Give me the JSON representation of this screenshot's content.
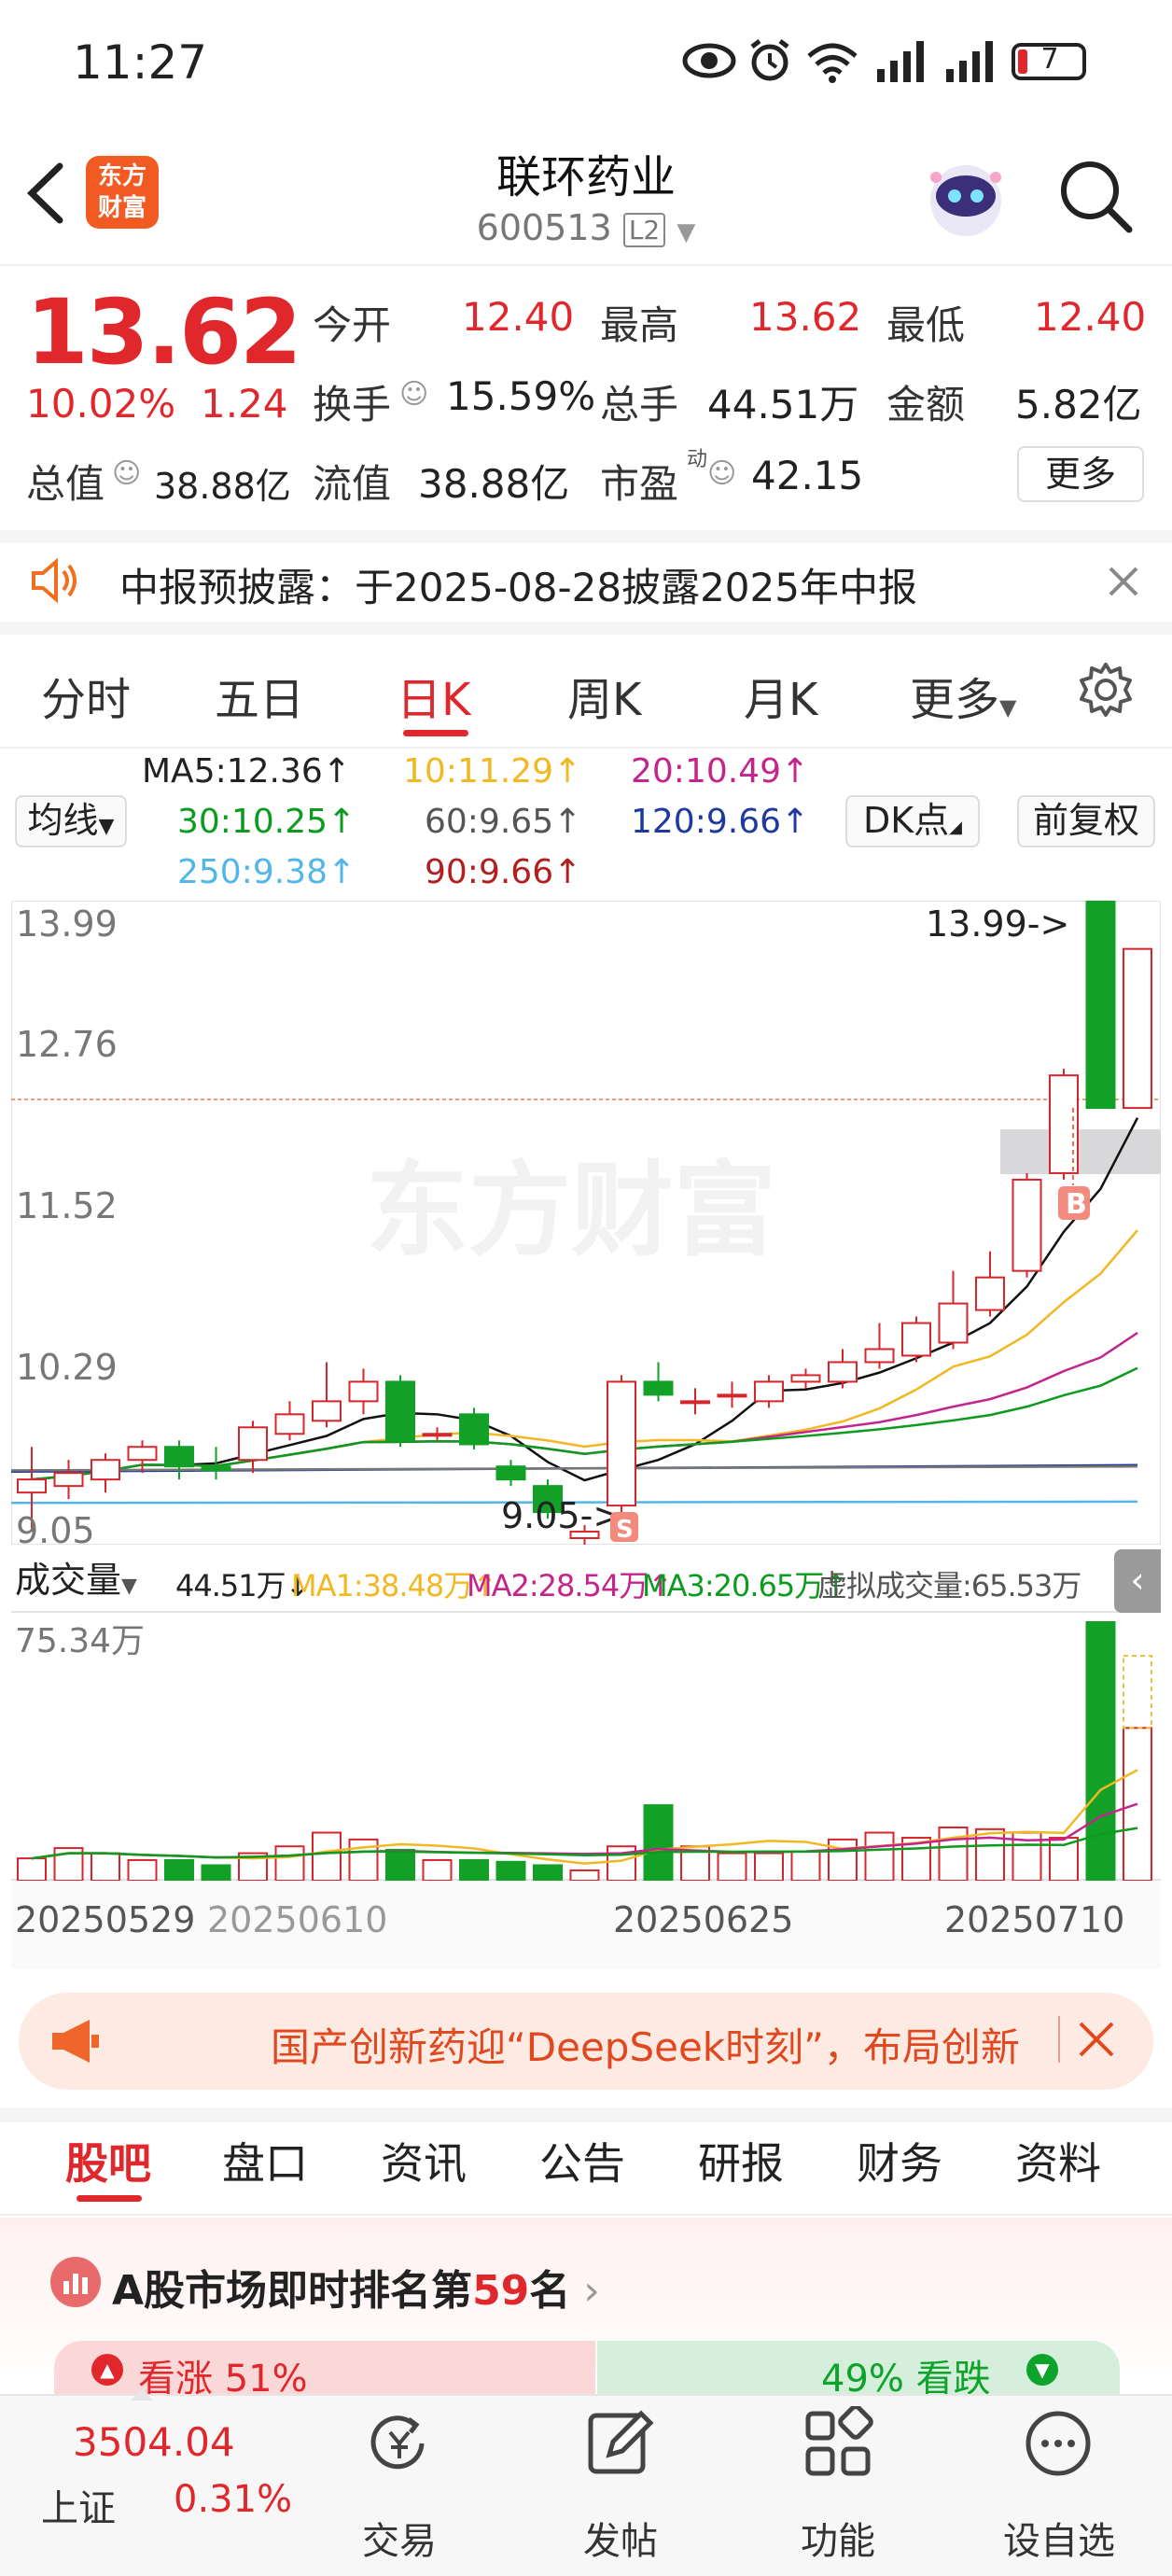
{
  "status": {
    "time": "11:27",
    "battery": "7"
  },
  "header": {
    "title": "联环药业",
    "code": "600513",
    "level": "L2",
    "logo_line1": "东方",
    "logo_line2": "财富"
  },
  "quote": {
    "price": "13.62",
    "change_pct": "10.02%",
    "change": "1.24",
    "open_label": "今开",
    "open": "12.40",
    "high_label": "最高",
    "high": "13.62",
    "low_label": "最低",
    "low": "12.40",
    "turnover_label": "换手",
    "turnover": "15.59%",
    "volume_label": "总手",
    "volume": "44.51万",
    "amount_label": "金额",
    "amount": "5.82亿",
    "mcap_label": "总值",
    "mcap": "38.88亿",
    "float_label": "流值",
    "float": "38.88亿",
    "pe_label": "市盈",
    "pe_sup": "动",
    "pe": "42.15",
    "more": "更多"
  },
  "notice": {
    "text": "中报预披露：于2025-08-28披露2025年中报"
  },
  "tabs": [
    "分时",
    "五日",
    "日K",
    "周K",
    "月K",
    "更多"
  ],
  "ma": {
    "select": "均线",
    "ma5": "MA5:12.36↑",
    "ma10": "10:11.29↑",
    "ma20": "20:10.49↑",
    "ma30": "30:10.25↑",
    "ma60": "60:9.65↑",
    "ma120": "120:9.66↑",
    "ma250": "250:9.38↑",
    "ma90": "90:9.66↑",
    "dk": "DK点",
    "fq": "前复权"
  },
  "chart_labels": {
    "y_top": "13.99",
    "y2": "12.76",
    "y3": "11.52",
    "y4": "10.29",
    "y_bottom": "9.05",
    "max_marker": "13.99->",
    "min_marker": "9.05->",
    "watermark": "东方财富",
    "buy": "B",
    "sell": "S"
  },
  "volume": {
    "select": "成交量",
    "vol": "44.51万↓",
    "ma1": "MA1:38.48万↑",
    "ma2": "MA2:28.54万↑",
    "ma3": "MA3:20.65万↑",
    "virtual": "虚拟成交量:65.53万",
    "y_max": "75.34万"
  },
  "dates": [
    "20250529",
    "20250610",
    "20250625",
    "20250710"
  ],
  "chart_data": {
    "type": "candlestick",
    "ylim": [
      9.05,
      13.99
    ],
    "candles": [
      {
        "o": 9.45,
        "c": 9.55,
        "h": 9.8,
        "l": 9.15,
        "v": 6.5
      },
      {
        "o": 9.5,
        "c": 9.6,
        "h": 9.7,
        "l": 9.4,
        "v": 9.5
      },
      {
        "o": 9.55,
        "c": 9.7,
        "h": 9.75,
        "l": 9.45,
        "v": 8.0
      },
      {
        "o": 9.7,
        "c": 9.8,
        "h": 9.85,
        "l": 9.6,
        "v": 6.0
      },
      {
        "o": 9.8,
        "c": 9.65,
        "h": 9.85,
        "l": 9.55,
        "v": 6.0
      },
      {
        "o": 9.65,
        "c": 9.62,
        "h": 9.8,
        "l": 9.55,
        "v": 4.5
      },
      {
        "o": 9.7,
        "c": 9.95,
        "h": 10.0,
        "l": 9.6,
        "v": 8.0
      },
      {
        "o": 9.9,
        "c": 10.05,
        "h": 10.15,
        "l": 9.85,
        "v": 10.0
      },
      {
        "o": 10.0,
        "c": 10.15,
        "h": 10.45,
        "l": 9.95,
        "v": 14.0
      },
      {
        "o": 10.15,
        "c": 10.3,
        "h": 10.4,
        "l": 10.05,
        "v": 12.0
      },
      {
        "o": 10.3,
        "c": 9.85,
        "h": 10.35,
        "l": 9.8,
        "v": 9.0
      },
      {
        "o": 9.9,
        "c": 9.9,
        "h": 9.95,
        "l": 9.85,
        "v": 6.0
      },
      {
        "o": 10.05,
        "c": 9.82,
        "h": 10.1,
        "l": 9.78,
        "v": 6.0
      },
      {
        "o": 9.65,
        "c": 9.55,
        "h": 9.7,
        "l": 9.5,
        "v": 5.5
      },
      {
        "o": 9.5,
        "c": 9.3,
        "h": 9.55,
        "l": 9.25,
        "v": 4.5
      },
      {
        "o": 9.1,
        "c": 9.15,
        "h": 9.2,
        "l": 9.05,
        "v": 3.0
      },
      {
        "o": 9.35,
        "c": 10.3,
        "h": 10.35,
        "l": 9.3,
        "v": 10.0
      },
      {
        "o": 10.3,
        "c": 10.2,
        "h": 10.45,
        "l": 10.15,
        "v": 22.0
      },
      {
        "o": 10.15,
        "c": 10.15,
        "h": 10.25,
        "l": 10.05,
        "v": 10.0
      },
      {
        "o": 10.2,
        "c": 10.2,
        "h": 10.3,
        "l": 10.1,
        "v": 8.0
      },
      {
        "o": 10.15,
        "c": 10.3,
        "h": 10.35,
        "l": 10.1,
        "v": 8.0
      },
      {
        "o": 10.3,
        "c": 10.35,
        "h": 10.4,
        "l": 10.25,
        "v": 8.5
      },
      {
        "o": 10.3,
        "c": 10.45,
        "h": 10.55,
        "l": 10.25,
        "v": 12.0
      },
      {
        "o": 10.45,
        "c": 10.55,
        "h": 10.75,
        "l": 10.4,
        "v": 14.0
      },
      {
        "o": 10.5,
        "c": 10.75,
        "h": 10.8,
        "l": 10.45,
        "v": 12.5
      },
      {
        "o": 10.6,
        "c": 10.9,
        "h": 11.15,
        "l": 10.55,
        "v": 15.5
      },
      {
        "o": 10.85,
        "c": 11.1,
        "h": 11.3,
        "l": 10.8,
        "v": 15.0
      },
      {
        "o": 11.15,
        "c": 11.85,
        "h": 11.9,
        "l": 11.1,
        "v": 14.0
      },
      {
        "o": 11.9,
        "c": 12.65,
        "h": 12.7,
        "l": 11.85,
        "v": 12.5
      },
      {
        "o": 13.99,
        "c": 12.4,
        "h": 13.99,
        "l": 12.4,
        "v": 75.34
      },
      {
        "o": 12.4,
        "c": 13.62,
        "h": 13.62,
        "l": 12.4,
        "v": 44.51
      }
    ]
  },
  "banner": {
    "text": "国产创新药迎“DeepSeek时刻”，布局创新"
  },
  "subtabs": [
    "股吧",
    "盘口",
    "资讯",
    "公告",
    "研报",
    "财务",
    "资料"
  ],
  "rank": {
    "prefix": "A股市场即时排名第",
    "num": "59",
    "suffix": "名",
    "up": "看涨 51%",
    "down": "49% 看跌"
  },
  "bottom": {
    "index_value": "3504.04",
    "index_name": "上证",
    "index_change": "0.31%",
    "trade": "交易",
    "post": "发帖",
    "func": "功能",
    "watch": "设自选"
  }
}
